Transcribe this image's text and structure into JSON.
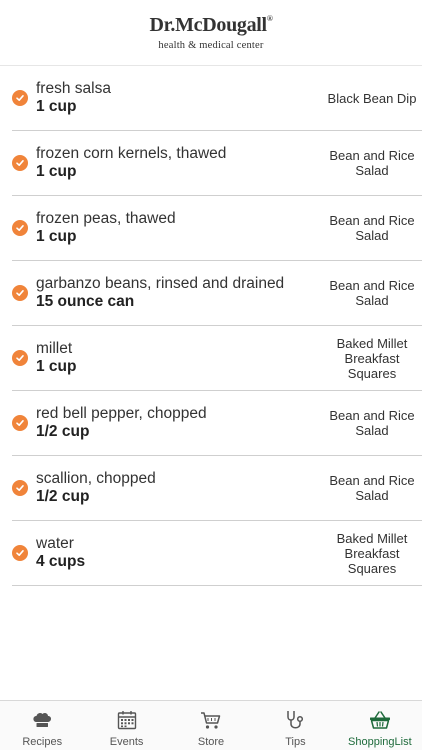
{
  "header": {
    "brand": "Dr.McDougall",
    "trademark": "®",
    "tagline": "health & medical center"
  },
  "items": [
    {
      "ingredient": "fresh salsa",
      "quantity": "1 cup",
      "recipe": "Black Bean Dip",
      "checked": true
    },
    {
      "ingredient": "frozen corn kernels, thawed",
      "quantity": "1 cup",
      "recipe": "Bean and Rice Salad",
      "checked": true
    },
    {
      "ingredient": "frozen peas, thawed",
      "quantity": "1 cup",
      "recipe": "Bean and Rice Salad",
      "checked": true
    },
    {
      "ingredient": "garbanzo beans, rinsed and drained",
      "quantity": "15 ounce can",
      "recipe": "Bean and Rice Salad",
      "checked": true
    },
    {
      "ingredient": "millet",
      "quantity": "1 cup",
      "recipe": "Baked Millet Breakfast Squares",
      "checked": true
    },
    {
      "ingredient": "red bell pepper, chopped",
      "quantity": "1/2 cup",
      "recipe": "Bean and Rice Salad",
      "checked": true
    },
    {
      "ingredient": "scallion, chopped",
      "quantity": "1/2 cup",
      "recipe": "Bean and Rice Salad",
      "checked": true
    },
    {
      "ingredient": "water",
      "quantity": "4 cups",
      "recipe": "Baked Millet Breakfast Squares",
      "checked": true
    }
  ],
  "tabs": [
    {
      "label": "Recipes",
      "icon": "chef-hat-icon"
    },
    {
      "label": "Events",
      "icon": "calendar-icon"
    },
    {
      "label": "Store",
      "icon": "cart-icon"
    },
    {
      "label": "Tips",
      "icon": "stethoscope-icon"
    },
    {
      "label": "ShoppingList",
      "icon": "basket-icon",
      "active": true
    }
  ],
  "colors": {
    "check": "#f0843a",
    "active_tab": "#1e6a3b",
    "icon": "#555555"
  }
}
